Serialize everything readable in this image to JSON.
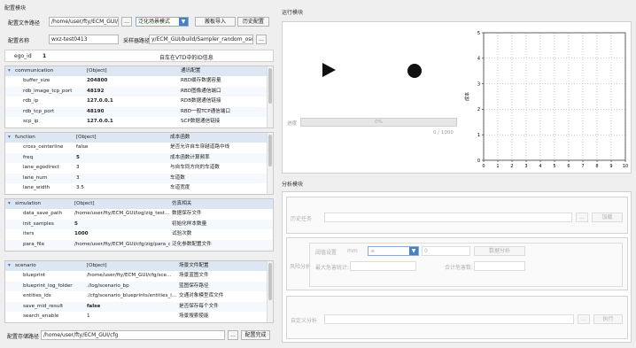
{
  "config": {
    "title": "配置模块",
    "file_path_label": "配置文件路径",
    "file_path_value": "/home/user/fty/ECM_GUI/cfg",
    "browse": "...",
    "mode": "泛化场景模式",
    "import_btn": "搬板导入",
    "history_btn": "历史配置",
    "name_label": "配置名称",
    "name_value": "wxz-test0413",
    "sampler_label": "采样器路径",
    "sampler_value": "y/ECM_GUI/build/Sampler_random_osc.sh",
    "ego_label": "ego_id",
    "ego_value": "1",
    "ego_desc": "自车在VTD中的ID信息"
  },
  "communication": {
    "rows": [
      [
        "communication",
        "[Object]",
        "通讯配置"
      ],
      [
        "buffer_size",
        "204800",
        "RBD缓存数据容量"
      ],
      [
        "rdb_image_tcp_port",
        "48192",
        "RBD图像通信端口"
      ],
      [
        "rdb_ip",
        "127.0.0.1",
        "RDB数据通信链接"
      ],
      [
        "rdb_tcp_port",
        "48190",
        "RBD一般TCP通信端口"
      ],
      [
        "scp_ip",
        "127.0.0.1",
        "SCP数据通信链接"
      ]
    ]
  },
  "function": {
    "rows": [
      [
        "function",
        "[Object]",
        "成本函数"
      ],
      [
        "cross_centerline",
        "false",
        "是否允许自车穿越道路中线"
      ],
      [
        "freq",
        "5",
        "成本函数计算频率"
      ],
      [
        "lane_egodirect",
        "3",
        "与自车同方向的车道数"
      ],
      [
        "lane_num",
        "3",
        "车道数"
      ],
      [
        "lane_width",
        "3.5",
        "车道宽度"
      ]
    ]
  },
  "simulation": {
    "rows": [
      [
        "simulation",
        "[Object]",
        "仿真相关"
      ],
      [
        "data_save_path",
        "/home/user/fty/ECM_GUI/log/zig_test...",
        "数据保存文件"
      ],
      [
        "init_samples",
        "5",
        "初始化样本数量"
      ],
      [
        "iters",
        "1000",
        "试验次数"
      ],
      [
        "para_file",
        "/home/user/fty/ECM_GUI/cfg/zig/para_cf...",
        "泛化参数配置文件"
      ]
    ]
  },
  "scenario": {
    "rows": [
      [
        "scenario",
        "[Object]",
        "场景文件配置"
      ],
      [
        "blueprint",
        "/home/user/fty/ECM_GUI/cfg/sce...",
        "场景蓝图文件"
      ],
      [
        "blueprint_log_folder",
        "./log/scenario_bp",
        "蓝图保存路径"
      ],
      [
        "entities_ids",
        "./cfg/scenario_blueprints/entities_l...",
        "交通对象模型库文件"
      ],
      [
        "save_mid_result",
        "false",
        "是否保存每个文件"
      ],
      [
        "search_enable",
        "1",
        "场景搜索使能"
      ]
    ]
  },
  "bottom": {
    "label": "配置存储路径",
    "path": "/home/user/fty/ECM_GUI/cfg",
    "browse": "...",
    "done_btn": "配置完成"
  },
  "run": {
    "title": "运行模块",
    "progress_label": "进度",
    "progress_text": "0%",
    "progress_value": 0,
    "counter": "0 / 1000",
    "ylabel": "成本"
  },
  "analysis": {
    "title": "分析模块",
    "history_label": "历史任务",
    "browse": "...",
    "load_btn": "加载",
    "risk_label": "风险分析",
    "threshold_label": "阈值设置",
    "unit": "mm",
    "dropdown_value": "≤",
    "num_value": "0",
    "calc_btn": "数据分析",
    "risk_stat_label": "最大危害统计:",
    "count_label": "合计危害数:",
    "custom_label": "自定义分析",
    "browse2": "...",
    "run_btn": "执行"
  },
  "chart_data": {
    "type": "line",
    "ylabel": "成本",
    "xlim": [
      0,
      10
    ],
    "ylim": [
      0,
      5
    ],
    "x_ticks": [
      "0",
      "1",
      "2",
      "3",
      "4",
      "5",
      "6",
      "7",
      "8",
      "9",
      "10"
    ],
    "y_ticks": [
      "0",
      "1",
      "2",
      "3",
      "4",
      "5"
    ],
    "series": []
  }
}
